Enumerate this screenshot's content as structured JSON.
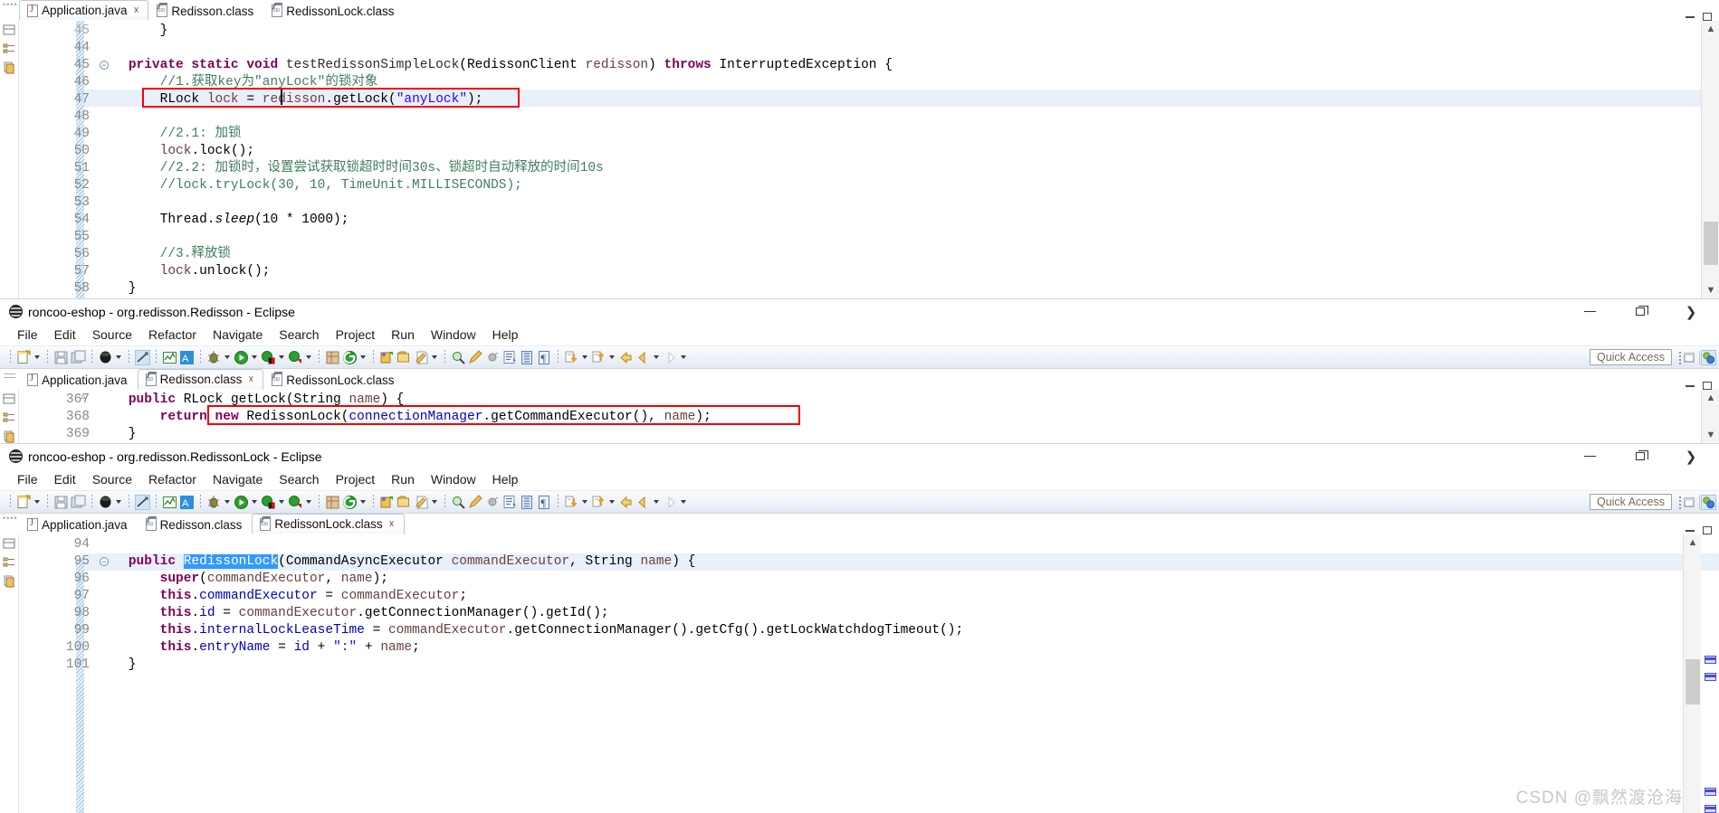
{
  "windows": [
    {
      "id": "w1",
      "tabs": [
        {
          "label": "Application.java",
          "icon": "java-file-icon",
          "active": true,
          "closable": true
        },
        {
          "label": "Redisson.class",
          "icon": "class-file-icon",
          "active": false,
          "closable": false
        },
        {
          "label": "RedissonLock.class",
          "icon": "class-file-icon",
          "active": false,
          "closable": false
        }
      ],
      "code_lines": [
        {
          "no": "45",
          "partial": true,
          "fold": "",
          "tokens": [
            {
              "t": "        }",
              "c": "pln"
            }
          ]
        },
        {
          "no": "44",
          "fold": "",
          "tokens": []
        },
        {
          "no": "45",
          "fold": "minus",
          "tokens": [
            {
              "t": "    ",
              "c": "pln"
            },
            {
              "t": "private static void ",
              "c": "kw"
            },
            {
              "t": "testRedissonSimpleLock",
              "c": "ty"
            },
            {
              "t": "(RedissonClient ",
              "c": "pln"
            },
            {
              "t": "redisson",
              "c": "par"
            },
            {
              "t": ") ",
              "c": "pln"
            },
            {
              "t": "throws ",
              "c": "kw"
            },
            {
              "t": "InterruptedException {",
              "c": "pln"
            }
          ]
        },
        {
          "no": "46",
          "fold": "",
          "tokens": [
            {
              "t": "        //1.获取key为\"anyLock\"的锁对象",
              "c": "cmt"
            }
          ]
        },
        {
          "no": "47",
          "fold": "",
          "highlight": true,
          "tokens": [
            {
              "t": "        RLock ",
              "c": "pln"
            },
            {
              "t": "lock ",
              "c": "par"
            },
            {
              "t": "= ",
              "c": "pln"
            },
            {
              "t": "redisson",
              "c": "par"
            },
            {
              "t": ".getLock(",
              "c": "pln"
            },
            {
              "t": "\"anyLock\"",
              "c": "str"
            },
            {
              "t": ");",
              "c": "pln"
            }
          ]
        },
        {
          "no": "48",
          "fold": "",
          "tokens": []
        },
        {
          "no": "49",
          "fold": "",
          "tokens": [
            {
              "t": "        //2.1: 加锁",
              "c": "cmt"
            }
          ]
        },
        {
          "no": "50",
          "fold": "",
          "tokens": [
            {
              "t": "        ",
              "c": "pln"
            },
            {
              "t": "lock",
              "c": "par"
            },
            {
              "t": ".lock();",
              "c": "pln"
            }
          ]
        },
        {
          "no": "51",
          "fold": "",
          "tokens": [
            {
              "t": "        //2.2: 加锁时，设置尝试获取锁超时时间30s、锁超时自动释放的时间10s",
              "c": "cmt"
            }
          ]
        },
        {
          "no": "52",
          "fold": "",
          "tokens": [
            {
              "t": "        //lock.tryLock(30, 10, TimeUnit.MILLISECONDS);",
              "c": "cmt"
            }
          ]
        },
        {
          "no": "53",
          "fold": "",
          "tokens": []
        },
        {
          "no": "54",
          "fold": "",
          "tokens": [
            {
              "t": "        Thread.",
              "c": "pln"
            },
            {
              "t": "sleep",
              "c": "sta"
            },
            {
              "t": "(10 * 1000);",
              "c": "pln"
            }
          ]
        },
        {
          "no": "55",
          "fold": "",
          "tokens": []
        },
        {
          "no": "56",
          "fold": "",
          "tokens": [
            {
              "t": "        //3.释放锁",
              "c": "cmt"
            }
          ]
        },
        {
          "no": "57",
          "fold": "",
          "tokens": [
            {
              "t": "        ",
              "c": "pln"
            },
            {
              "t": "lock",
              "c": "par"
            },
            {
              "t": ".unlock();",
              "c": "pln"
            }
          ]
        },
        {
          "no": "58",
          "fold": "",
          "tokens": [
            {
              "t": "    }",
              "c": "pln"
            }
          ]
        }
      ]
    },
    {
      "id": "w2",
      "title": "roncoo-eshop - org.redisson.Redisson - Eclipse",
      "menu": [
        "File",
        "Edit",
        "Source",
        "Refactor",
        "Navigate",
        "Search",
        "Project",
        "Run",
        "Window",
        "Help"
      ],
      "quick_access": "Quick Access",
      "tabs": [
        {
          "label": "Application.java",
          "icon": "java-file-icon",
          "active": false,
          "closable": false
        },
        {
          "label": "Redisson.class",
          "icon": "class-file-icon",
          "active": true,
          "closable": true
        },
        {
          "label": "RedissonLock.class",
          "icon": "class-file-icon",
          "active": false,
          "closable": false
        }
      ],
      "code_lines": [
        {
          "no": "367",
          "fold": "tri",
          "tokens": [
            {
              "t": "    ",
              "c": "pln"
            },
            {
              "t": "public ",
              "c": "kw"
            },
            {
              "t": "RLock getLock(String ",
              "c": "pln"
            },
            {
              "t": "name",
              "c": "par"
            },
            {
              "t": ") {",
              "c": "pln"
            }
          ]
        },
        {
          "no": "368",
          "fold": "",
          "tokens": [
            {
              "t": "        ",
              "c": "pln"
            },
            {
              "t": "return ",
              "c": "kw"
            },
            {
              "t": "new ",
              "c": "kw"
            },
            {
              "t": "RedissonLock(",
              "c": "pln"
            },
            {
              "t": "connectionManager",
              "c": "fld"
            },
            {
              "t": ".getCommandExecutor(), ",
              "c": "pln"
            },
            {
              "t": "name",
              "c": "par"
            },
            {
              "t": ");",
              "c": "pln"
            }
          ]
        },
        {
          "no": "369",
          "fold": "",
          "tokens": [
            {
              "t": "    }",
              "c": "pln"
            }
          ]
        }
      ]
    },
    {
      "id": "w3",
      "title": "roncoo-eshop - org.redisson.RedissonLock - Eclipse",
      "menu": [
        "File",
        "Edit",
        "Source",
        "Refactor",
        "Navigate",
        "Search",
        "Project",
        "Run",
        "Window",
        "Help"
      ],
      "quick_access": "Quick Access",
      "tabs": [
        {
          "label": "Application.java",
          "icon": "java-file-icon",
          "active": false,
          "closable": false
        },
        {
          "label": "Redisson.class",
          "icon": "class-file-icon",
          "active": false,
          "closable": false
        },
        {
          "label": "RedissonLock.class",
          "icon": "class-file-icon",
          "active": true,
          "closable": true
        }
      ],
      "code_lines": [
        {
          "no": "94",
          "fold": "",
          "tokens": []
        },
        {
          "no": "95",
          "fold": "minus",
          "highlight": true,
          "tokens": [
            {
              "t": "    ",
              "c": "pln"
            },
            {
              "t": "public ",
              "c": "kw"
            },
            {
              "t": "RedissonLock",
              "c": "sel"
            },
            {
              "t": "(CommandAsyncExecutor ",
              "c": "pln"
            },
            {
              "t": "commandExecutor",
              "c": "par"
            },
            {
              "t": ", String ",
              "c": "pln"
            },
            {
              "t": "name",
              "c": "par"
            },
            {
              "t": ") {",
              "c": "pln"
            }
          ]
        },
        {
          "no": "96",
          "fold": "",
          "tokens": [
            {
              "t": "        ",
              "c": "pln"
            },
            {
              "t": "super",
              "c": "kw"
            },
            {
              "t": "(",
              "c": "pln"
            },
            {
              "t": "commandExecutor",
              "c": "par"
            },
            {
              "t": ", ",
              "c": "pln"
            },
            {
              "t": "name",
              "c": "par"
            },
            {
              "t": ");",
              "c": "pln"
            }
          ]
        },
        {
          "no": "97",
          "fold": "",
          "tokens": [
            {
              "t": "        ",
              "c": "pln"
            },
            {
              "t": "this",
              "c": "kw"
            },
            {
              "t": ".",
              "c": "pln"
            },
            {
              "t": "commandExecutor",
              "c": "fld"
            },
            {
              "t": " = ",
              "c": "pln"
            },
            {
              "t": "commandExecutor",
              "c": "par"
            },
            {
              "t": ";",
              "c": "pln"
            }
          ]
        },
        {
          "no": "98",
          "fold": "",
          "tokens": [
            {
              "t": "        ",
              "c": "pln"
            },
            {
              "t": "this",
              "c": "kw"
            },
            {
              "t": ".",
              "c": "pln"
            },
            {
              "t": "id",
              "c": "fld"
            },
            {
              "t": " = ",
              "c": "pln"
            },
            {
              "t": "commandExecutor",
              "c": "par"
            },
            {
              "t": ".getConnectionManager().getId();",
              "c": "pln"
            }
          ]
        },
        {
          "no": "99",
          "fold": "",
          "tokens": [
            {
              "t": "        ",
              "c": "pln"
            },
            {
              "t": "this",
              "c": "kw"
            },
            {
              "t": ".",
              "c": "pln"
            },
            {
              "t": "internalLockLeaseTime",
              "c": "fld"
            },
            {
              "t": " = ",
              "c": "pln"
            },
            {
              "t": "commandExecutor",
              "c": "par"
            },
            {
              "t": ".getConnectionManager().getCfg().getLockWatchdogTimeout();",
              "c": "pln"
            }
          ]
        },
        {
          "no": "100",
          "fold": "",
          "tokens": [
            {
              "t": "        ",
              "c": "pln"
            },
            {
              "t": "this",
              "c": "kw"
            },
            {
              "t": ".",
              "c": "pln"
            },
            {
              "t": "entryName",
              "c": "fld"
            },
            {
              "t": " = ",
              "c": "pln"
            },
            {
              "t": "id",
              "c": "fld"
            },
            {
              "t": " + ",
              "c": "pln"
            },
            {
              "t": "\":\"",
              "c": "str"
            },
            {
              "t": " + ",
              "c": "pln"
            },
            {
              "t": "name",
              "c": "par"
            },
            {
              "t": ";",
              "c": "pln"
            }
          ]
        },
        {
          "no": "101",
          "fold": "",
          "tokens": [
            {
              "t": "    }",
              "c": "pln"
            }
          ]
        }
      ]
    }
  ],
  "watermark": "CSDN @飘然渡沧海",
  "colors": {
    "annotation_box": "#f40000",
    "selection": "#3399ff",
    "line_highlight": "#e8f0fb",
    "keyword": "#7f0055",
    "string": "#2a00ff",
    "comment": "#3f7f5f",
    "field": "#0000c0",
    "param": "#6a3e3e"
  }
}
